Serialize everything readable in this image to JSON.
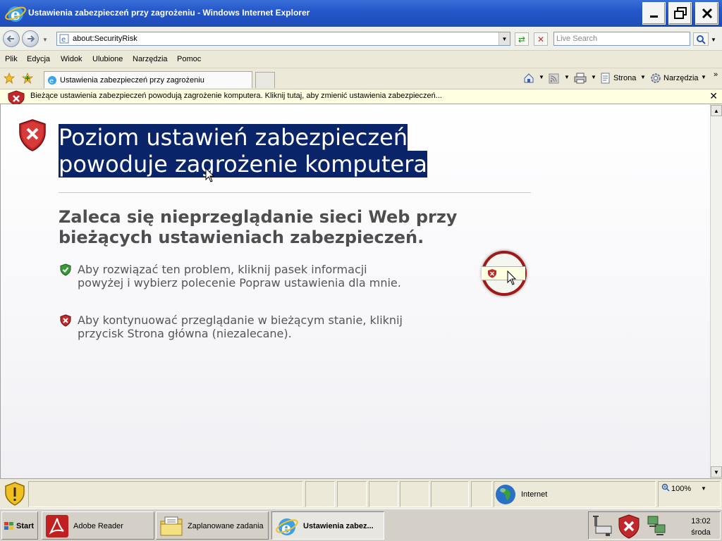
{
  "window": {
    "title": "Ustawienia zabezpieczeń przy zagrożeniu - Windows Internet Explorer"
  },
  "address_bar": {
    "url": "about:SecurityRisk",
    "search_placeholder": "Live Search"
  },
  "menu": [
    "Plik",
    "Edycja",
    "Widok",
    "Ulubione",
    "Narzędzia",
    "Pomoc"
  ],
  "tab": {
    "label": "Ustawienia zabezpieczeń przy zagrożeniu"
  },
  "command_bar": {
    "page_label": "Strona",
    "tools_label": "Narzędzia"
  },
  "info_bar": {
    "text": "Bieżące ustawienia zabezpieczeń powodują zagrożenie komputera. Kliknij tutaj, aby zmienić ustawienia zabezpieczeń..."
  },
  "content": {
    "heading_line1": "Poziom ustawień zabezpieczeń ",
    "heading_line2": "powoduje zagrożenie komputera",
    "subheading": "Zaleca się nieprzeglądanie sieci Web przy bieżących ustawieniach zabezpieczeń.",
    "tip1_line1": "Aby rozwiązać ten problem, kliknij pasek informacji",
    "tip1_line2": "powyżej i wybierz polecenie Popraw ustawienia dla mnie.",
    "tip2_line1": "Aby kontynuować przeglądanie w bieżącym stanie, kliknij",
    "tip2_line2": "przycisk Strona główna (niezalecane)."
  },
  "status_bar": {
    "zone": "Internet",
    "zoom": "100%"
  },
  "taskbar": {
    "start": "Start",
    "tasks": [
      "Adobe Reader",
      "Zaplanowane zadania",
      "Ustawienia zabez..."
    ],
    "clock_time": "13:02",
    "clock_day": "środa"
  },
  "colors": {
    "title_bar": "#2457c9",
    "selection": "#0a246a",
    "info_bar": "#ffffe1",
    "shield_red": "#c0282c",
    "shield_green": "#3a9a3a"
  }
}
